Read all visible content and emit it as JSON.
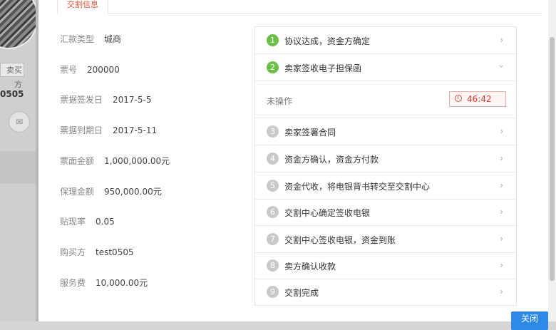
{
  "backdrop": {
    "tag_label": "卖买方",
    "user_fragment": "0505",
    "mail_icon": "✉"
  },
  "modal": {
    "tab_label": "交割信息",
    "close_label": "关闭"
  },
  "info": [
    {
      "label": "汇款类型",
      "value": "城商"
    },
    {
      "label": "票号",
      "value": "200000"
    },
    {
      "label": "票据签发日",
      "value": "2017-5-5"
    },
    {
      "label": "票据到期日",
      "value": "2017-5-11"
    },
    {
      "label": "票面金额",
      "value": "1,000,000.00元"
    },
    {
      "label": "保理金额",
      "value": "950,000.00元"
    },
    {
      "label": "贴现率",
      "value": "0.05"
    },
    {
      "label": "购买方",
      "value": "test0505"
    },
    {
      "label": "服务费",
      "value": "10,000.00元"
    }
  ],
  "steps": [
    {
      "num": "1",
      "label": "协议达成，资金方确定",
      "state": "done"
    },
    {
      "num": "2",
      "label": "卖家签收电子担保函",
      "state": "active"
    },
    {
      "num": "3",
      "label": "卖家签署合同",
      "state": "pending"
    },
    {
      "num": "4",
      "label": "资金方确认，资金方付款",
      "state": "pending"
    },
    {
      "num": "5",
      "label": "资金代收，将电银背书转交至交割中心",
      "state": "pending"
    },
    {
      "num": "6",
      "label": "交割中心确定签收电银",
      "state": "pending"
    },
    {
      "num": "7",
      "label": "交割中心签收电银，资金到账",
      "state": "pending"
    },
    {
      "num": "8",
      "label": "卖方确认收款",
      "state": "pending"
    },
    {
      "num": "9",
      "label": "交割完成",
      "state": "pending"
    }
  ],
  "expanded_step": {
    "status": "未操作",
    "countdown": "46:42"
  },
  "colors": {
    "active_step": "#6cc04a",
    "pending_step": "#c9c9c9",
    "tab_accent": "#e0563a",
    "timer_red": "#d9372b",
    "primary_button": "#2e8ae6"
  }
}
